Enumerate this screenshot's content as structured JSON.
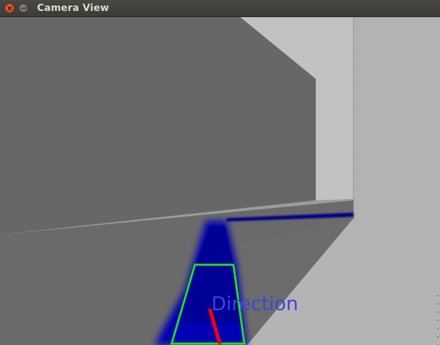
{
  "window": {
    "title": "Camera View",
    "close_icon": "close-icon",
    "minimize_icon": "minimize-icon"
  },
  "overlay": {
    "direction_label": "Direction",
    "lane_box_color": "#22e022",
    "direction_line_color": "#ff0000",
    "lane_fill_color": "#0000b4",
    "label_color": "#3a46d8"
  }
}
